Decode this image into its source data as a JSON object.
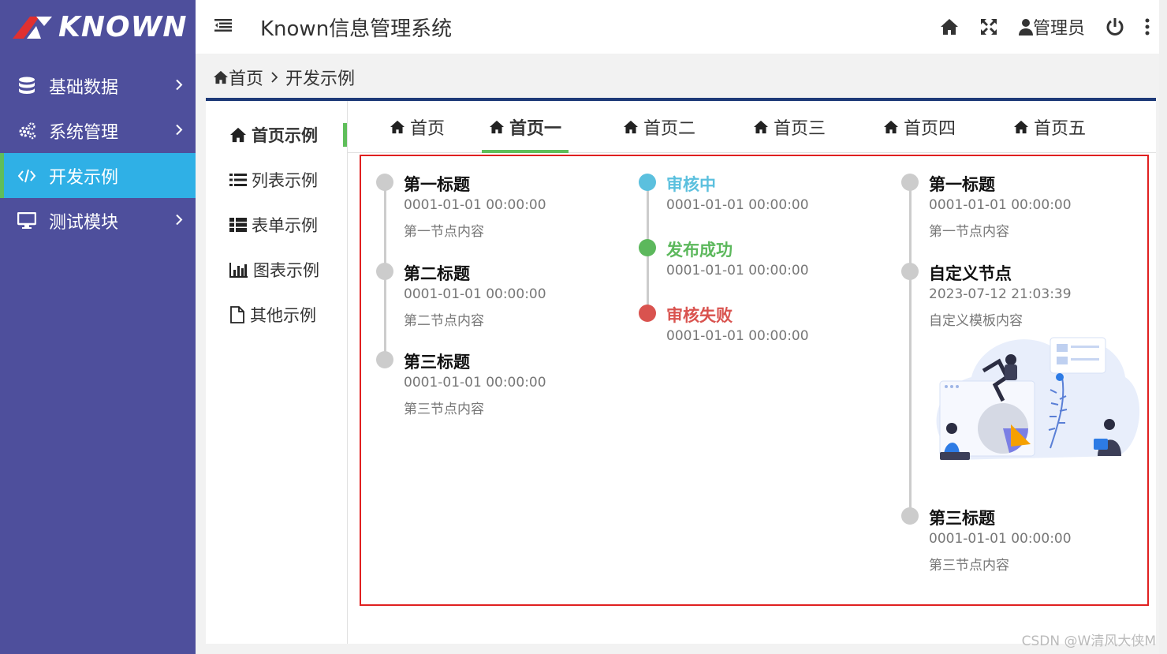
{
  "logo": {
    "text": "KNOWN"
  },
  "sidebar": {
    "items": [
      {
        "label": "基础数据",
        "icon": "database-icon"
      },
      {
        "label": "系统管理",
        "icon": "gears-icon"
      },
      {
        "label": "开发示例",
        "icon": "code-icon"
      },
      {
        "label": "测试模块",
        "icon": "desktop-icon"
      }
    ]
  },
  "header": {
    "title": "Known信息管理系统",
    "user": "管理员"
  },
  "breadcrumb": {
    "home": "首页",
    "current": "开发示例"
  },
  "side_tabs": [
    {
      "label": "首页示例",
      "icon": "home-icon"
    },
    {
      "label": "列表示例",
      "icon": "list-icon"
    },
    {
      "label": "表单示例",
      "icon": "table-icon"
    },
    {
      "label": "图表示例",
      "icon": "bar-chart-icon"
    },
    {
      "label": "其他示例",
      "icon": "file-icon"
    }
  ],
  "top_tabs": [
    {
      "label": "首页"
    },
    {
      "label": "首页一"
    },
    {
      "label": "首页二"
    },
    {
      "label": "首页三"
    },
    {
      "label": "首页四"
    },
    {
      "label": "首页五"
    }
  ],
  "timeline1": [
    {
      "title": "第一标题",
      "time": "0001-01-01 00:00:00",
      "content": "第一节点内容"
    },
    {
      "title": "第二标题",
      "time": "0001-01-01 00:00:00",
      "content": "第二节点内容"
    },
    {
      "title": "第三标题",
      "time": "0001-01-01 00:00:00",
      "content": "第三节点内容"
    }
  ],
  "timeline2": [
    {
      "title": "审核中",
      "time": "0001-01-01 00:00:00",
      "color": "#5bc0de"
    },
    {
      "title": "发布成功",
      "time": "0001-01-01 00:00:00",
      "color": "#5cb85c"
    },
    {
      "title": "审核失败",
      "time": "0001-01-01 00:00:00",
      "color": "#d9534f"
    }
  ],
  "timeline3": [
    {
      "title": "第一标题",
      "time": "0001-01-01 00:00:00",
      "content": "第一节点内容"
    },
    {
      "title": "自定义节点",
      "time": "2023-07-12 21:03:39",
      "content": "自定义模板内容"
    },
    {
      "title": "第三标题",
      "time": "0001-01-01 00:00:00",
      "content": "第三节点内容"
    }
  ],
  "colors": {
    "sidebar_bg": "#4e4f9c",
    "active_menu": "#2fb0e6",
    "accent_green": "#5fbe5a",
    "card_border": "#1e3a78",
    "highlight_box": "#e02020"
  },
  "watermark": "CSDN @W清风大侠M"
}
